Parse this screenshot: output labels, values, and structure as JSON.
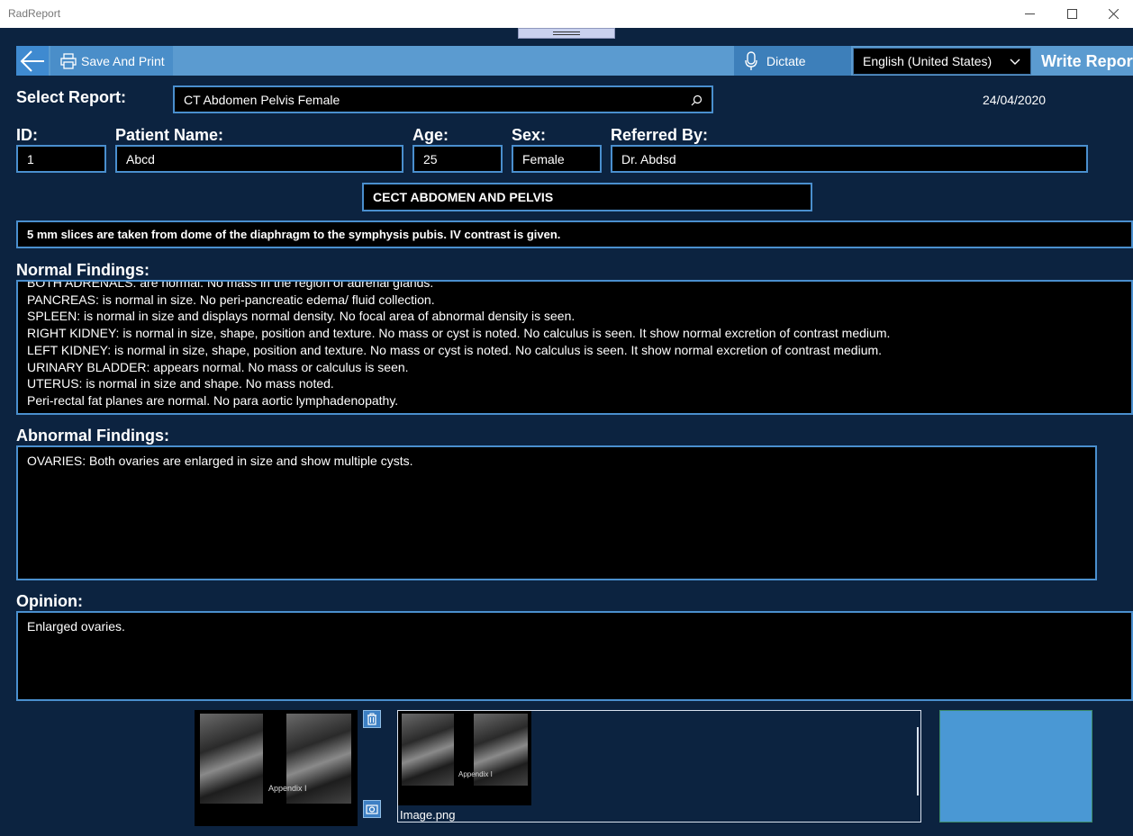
{
  "window": {
    "title": "RadReport",
    "minimize_glyph": "—",
    "maximize_glyph": "☐",
    "close_glyph": "✕"
  },
  "toolbar": {
    "back_icon": "arrow-left-icon",
    "save_label": "Save And Print",
    "dictate_label": "Dictate",
    "language": "English (United States)",
    "write_report_label": "Write Report"
  },
  "report": {
    "select_label": "Select Report:",
    "selected": "CT Abdomen Pelvis Female",
    "date": "24/04/2020"
  },
  "patient": {
    "id_label": "ID:",
    "id": "1",
    "name_label": "Patient Name:",
    "name": "Abcd",
    "age_label": "Age:",
    "age": "25",
    "sex_label": "Sex:",
    "sex": "Female",
    "referred_label": "Referred By:",
    "referred_by": "Dr. Abdsd"
  },
  "study": {
    "title": "CECT ABDOMEN AND PELVIS",
    "technique": "5 mm slices are taken from dome of the diaphragm to the symphysis pubis. IV contrast is given."
  },
  "normal_findings": {
    "label": "Normal Findings:",
    "lines": [
      "BOTH ADRENALS: are normal. No mass in the region of adrenal glands.",
      "PANCREAS: is normal in size. No peri-pancreatic edema/ fluid collection.",
      "SPLEEN: is normal in size and displays normal density. No focal area of abnormal density is seen.",
      "RIGHT KIDNEY: is normal in size, shape, position and texture. No mass or cyst is noted. No calculus is seen. It show normal excretion of contrast medium.",
      "LEFT KIDNEY: is normal in size, shape, position and texture. No mass or cyst is noted. No calculus is seen. It show normal excretion of contrast medium.",
      "URINARY BLADDER: appears normal. No mass or calculus is seen.",
      "UTERUS: is normal in size and shape. No mass noted.",
      "Peri-rectal fat planes are normal. No para aortic lymphadenopathy."
    ]
  },
  "abnormal_findings": {
    "label": "Abnormal Findings:",
    "text": "OVARIES: Both ovaries are enlarged in size and show multiple cysts."
  },
  "opinion": {
    "label": "Opinion:",
    "text": "Enlarged ovaries."
  },
  "images": {
    "caption": "Appendix I",
    "filename": "Image.png",
    "delete_icon": "trash-icon",
    "camera_icon": "camera-icon"
  },
  "colors": {
    "background": "#0c2340",
    "toolbar": "#5b9bd0",
    "field_border": "#4a8fce",
    "preview": "#4a98d4"
  }
}
